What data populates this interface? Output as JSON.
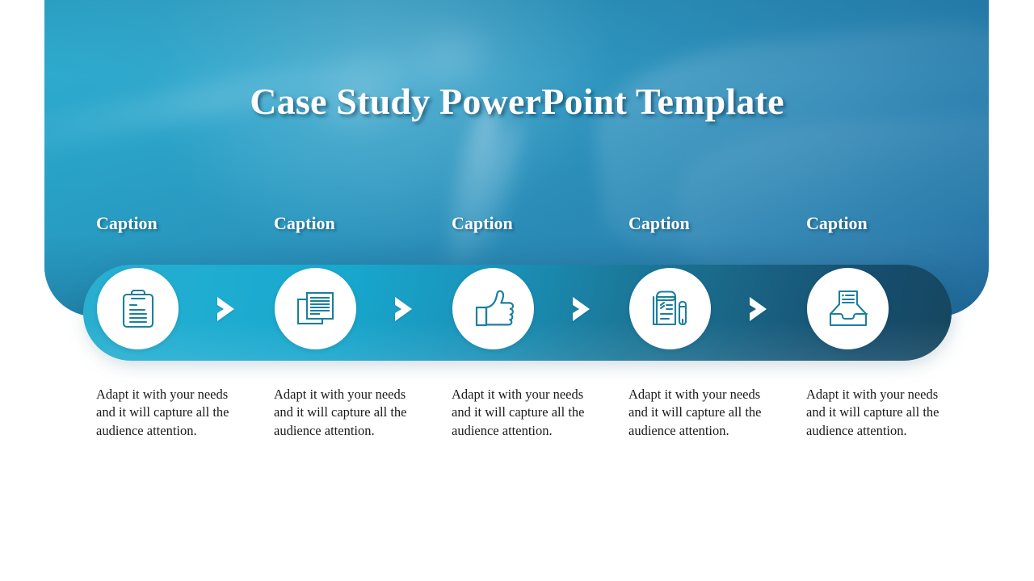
{
  "slide": {
    "title": "Case Study PowerPoint Template",
    "background": {
      "banner_accent": "#2e86ab",
      "ribbon_gradient_start": "#2aaecf",
      "ribbon_gradient_end": "#16465f",
      "icon_stroke_color": "#1b7f9e",
      "circle_fill": "#ffffff",
      "title_color": "#ffffff",
      "body_text_color": "#1a1a1a",
      "page_background": "#ffffff",
      "photo_description": "blurred hand writing with a pen on documents"
    }
  },
  "steps": [
    {
      "caption": "Caption",
      "icon": "clipboard-icon",
      "body": "Adapt it with your needs and it will capture all the audience attention."
    },
    {
      "caption": "Caption",
      "icon": "documents-stack-icon",
      "body": "Adapt it with your needs and it will capture all the audience attention."
    },
    {
      "caption": "Caption",
      "icon": "thumbs-up-icon",
      "body": "Adapt it with your needs and it will capture all the audience attention."
    },
    {
      "caption": "Caption",
      "icon": "notepad-pen-icon",
      "body": "Adapt it with your needs and it will capture all the audience attention."
    },
    {
      "caption": "Caption",
      "icon": "inbox-tray-icon",
      "body": "Adapt it with your needs and it will capture all the audience attention."
    }
  ],
  "connectors": [
    {
      "icon": "chevron-right-icon"
    },
    {
      "icon": "chevron-right-icon"
    },
    {
      "icon": "chevron-right-icon"
    },
    {
      "icon": "chevron-right-icon"
    }
  ]
}
